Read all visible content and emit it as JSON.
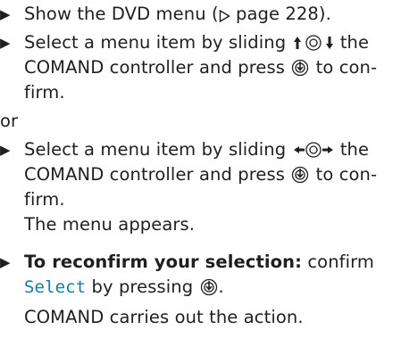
{
  "steps": {
    "s1": {
      "text_before": "Show the DVD menu (",
      "page_ref": "page 228",
      "text_after": ")."
    },
    "s2": {
      "line1_before": "Select a menu item by sliding ",
      "line1_after": " the",
      "line2_before": "COMAND controller and press ",
      "line2_after": " to con-",
      "line3": "firm."
    },
    "or": "or",
    "s3": {
      "line1_before": "Select a menu item by sliding ",
      "line1_after": " the",
      "line2_before": "COMAND controller and press ",
      "line2_after": " to con-",
      "line3": "firm.",
      "result": "The menu appears."
    },
    "s4": {
      "bold": "To reconfirm your selection:",
      "line1_after": " confirm",
      "select": "Select",
      "line2_after": " by pressing ",
      "line2_end": ".",
      "result": "COMAND carries out the action."
    }
  },
  "icons": {
    "bullet": "triangle-bullet-icon",
    "page_ref": "page-reference-triangle-icon",
    "slide_vertical": "controller-slide-up-down-icon",
    "slide_horizontal": "controller-slide-left-right-icon",
    "press": "controller-press-icon"
  },
  "colors": {
    "text": "#1f1f1f",
    "select_highlight": "#0a7ebf"
  }
}
